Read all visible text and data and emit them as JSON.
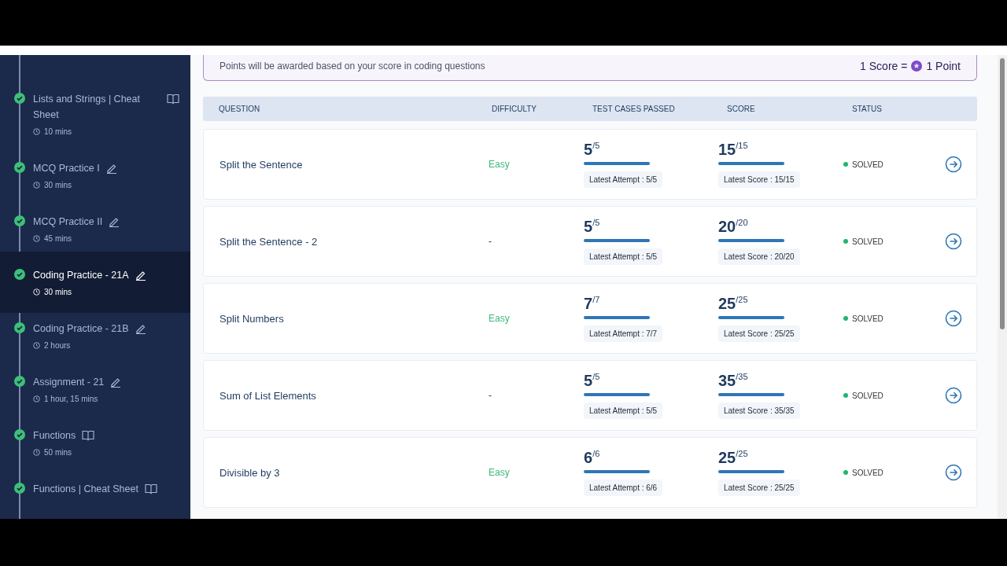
{
  "sidebar": {
    "items": [
      {
        "title": "Lists and Strings | Cheat Sheet",
        "duration": "10 mins",
        "kind": "reading",
        "done": true,
        "selected": false
      },
      {
        "title": "MCQ Practice I",
        "duration": "30 mins",
        "kind": "practice",
        "done": true,
        "selected": false
      },
      {
        "title": "MCQ Practice II",
        "duration": "45 mins",
        "kind": "practice",
        "done": true,
        "selected": false
      },
      {
        "title": "Coding Practice - 21A",
        "duration": "30 mins",
        "kind": "practice",
        "done": true,
        "selected": true
      },
      {
        "title": "Coding Practice - 21B",
        "duration": "2 hours",
        "kind": "practice",
        "done": true,
        "selected": false
      },
      {
        "title": "Assignment - 21",
        "duration": "1 hour, 15 mins",
        "kind": "practice",
        "done": true,
        "selected": false
      },
      {
        "title": "Functions",
        "duration": "50 mins",
        "kind": "reading",
        "done": true,
        "selected": false
      },
      {
        "title": "Functions | Cheat Sheet",
        "kind": "reading",
        "done": true,
        "selected": false
      }
    ]
  },
  "notice": {
    "text": "Points will be awarded based on your score in coding questions",
    "rate_left": "1 Score =",
    "rate_right": "1 Point"
  },
  "table": {
    "columns": [
      "QUESTION",
      "DIFFICULTY",
      "TEST CASES PASSED",
      "SCORE",
      "STATUS"
    ],
    "rows": [
      {
        "question": "Split the Sentence",
        "difficulty": "Easy",
        "tests": {
          "value": "5",
          "total": "/5",
          "level": 1,
          "latest": "Latest Attempt : 5/5"
        },
        "score": {
          "value": "15",
          "total": "/15",
          "level": 1,
          "latest": "Latest Score : 15/15"
        },
        "status": "SOLVED"
      },
      {
        "question": "Split the Sentence - 2",
        "difficulty": "-",
        "tests": {
          "value": "5",
          "total": "/5",
          "level": 1,
          "latest": "Latest Attempt : 5/5"
        },
        "score": {
          "value": "20",
          "total": "/20",
          "level": 1,
          "latest": "Latest Score : 20/20"
        },
        "status": "SOLVED"
      },
      {
        "question": "Split Numbers",
        "difficulty": "Easy",
        "tests": {
          "value": "7",
          "total": "/7",
          "level": 1,
          "latest": "Latest Attempt : 7/7"
        },
        "score": {
          "value": "25",
          "total": "/25",
          "level": 1,
          "latest": "Latest Score : 25/25"
        },
        "status": "SOLVED"
      },
      {
        "question": "Sum of List Elements",
        "difficulty": "-",
        "tests": {
          "value": "5",
          "total": "/5",
          "level": 1,
          "latest": "Latest Attempt : 5/5"
        },
        "score": {
          "value": "35",
          "total": "/35",
          "level": 1,
          "latest": "Latest Score : 35/35"
        },
        "status": "SOLVED"
      },
      {
        "question": "Divisible by 3",
        "difficulty": "Easy",
        "tests": {
          "value": "6",
          "total": "/6",
          "level": 1,
          "latest": "Latest Attempt : 6/6"
        },
        "score": {
          "value": "25",
          "total": "/25",
          "level": 1,
          "latest": "Latest Score : 25/25"
        },
        "status": "SOLVED"
      }
    ]
  }
}
